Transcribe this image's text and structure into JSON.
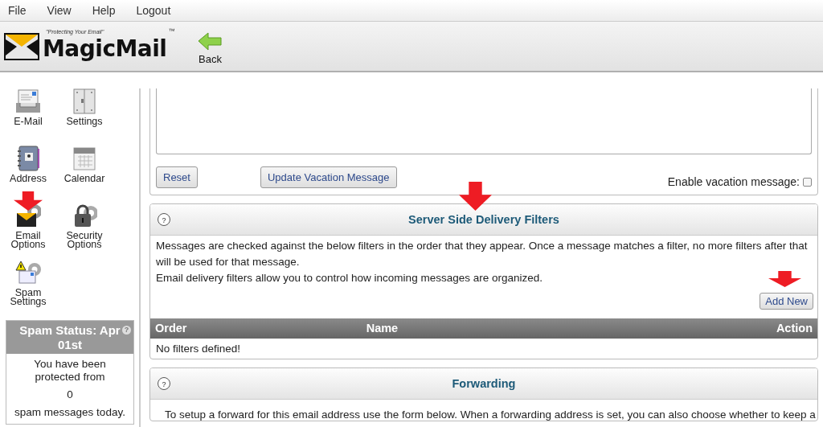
{
  "menu": [
    {
      "label": "File"
    },
    {
      "label": "View"
    },
    {
      "label": "Help"
    },
    {
      "label": "Logout"
    }
  ],
  "toolbar": {
    "logo_tagline": "\"Protecting Your Email\"",
    "logo_name": "MagicMail",
    "logo_mark": "™",
    "back_label": "Back"
  },
  "sidebar": {
    "items": [
      {
        "label": "E-Mail",
        "kind": "mail"
      },
      {
        "label": "Settings",
        "kind": "settings"
      },
      {
        "label": "Address",
        "kind": "address"
      },
      {
        "label": "Calendar",
        "kind": "calendar"
      },
      {
        "label": "Email Options",
        "kind": "email-options"
      },
      {
        "label": "Security Options",
        "kind": "security"
      },
      {
        "label": "Spam Settings",
        "kind": "spam"
      }
    ]
  },
  "spam_status": {
    "title": "Spam Status: Apr 01st",
    "help": "?",
    "lines": [
      "You have been protected from",
      "0",
      "spam messages today."
    ]
  },
  "vacation": {
    "buttons": [
      "Reset",
      "Update Vacation Message"
    ],
    "enable_label": "Enable vacation message:",
    "enabled": false
  },
  "filters": {
    "help": "?",
    "title": "Server Side Delivery Filters",
    "paragraphs": [
      "Messages are checked against the below filters in the order that they appear. Once a message matches a filter, no more filters after that will be used for that message.",
      "Email delivery filters allow you to control how incoming messages are organized."
    ],
    "add_button": "Add New",
    "columns": [
      "Order",
      "Name",
      "Action"
    ],
    "empty_message": "No filters defined!"
  },
  "forwarding": {
    "help": "?",
    "title": "Forwarding",
    "text": "To setup a forward for this email address use the form below. When a forwarding address is set, you can also choose whether to keep a"
  }
}
